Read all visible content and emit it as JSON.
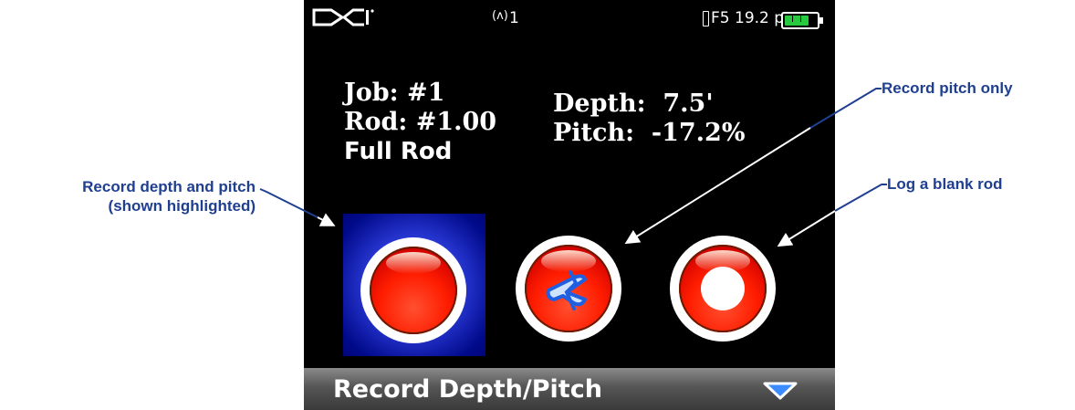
{
  "callouts": {
    "depth_pitch_line1": "Record depth and pitch",
    "depth_pitch_line2": "(shown highlighted)",
    "pitch_only": "Record pitch only",
    "blank_rod": "Log a blank rod"
  },
  "status_bar": {
    "logo": "DCI",
    "antenna_icon": "antenna-icon",
    "channel": "1",
    "frequency": "F5 19.2 p",
    "battery_level": 0.75,
    "battery_color": "#27c93f"
  },
  "job_info": {
    "job": "Job: #1",
    "rod": "Rod: #1.00",
    "rod_type": "Full Rod"
  },
  "readings": {
    "depth": "Depth:  7.5'",
    "pitch": "Pitch:  -17.2%"
  },
  "buttons": [
    {
      "name": "record-depth-pitch",
      "icon": "red-record-icon",
      "selected": true
    },
    {
      "name": "record-pitch-only",
      "icon": "blue-cross-icon",
      "selected": false
    },
    {
      "name": "log-blank-rod",
      "icon": "white-dot-icon",
      "selected": false
    }
  ],
  "bottom_bar": {
    "label": "Record Depth/Pitch",
    "menu_icon": "chevron-down-icon"
  },
  "colors": {
    "callout": "#1f3f91",
    "highlight": "#0014a8",
    "button_red": "#ff1d00"
  }
}
